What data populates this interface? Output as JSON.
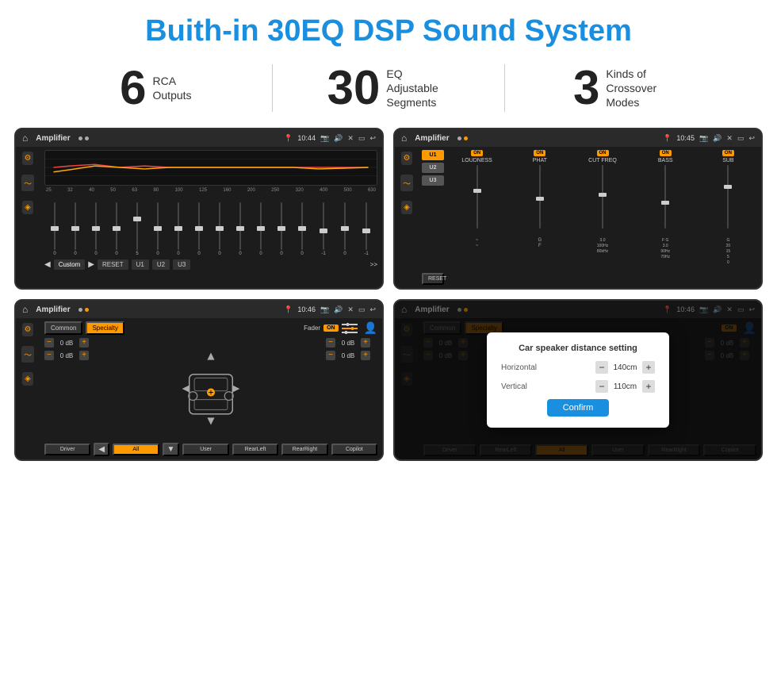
{
  "page": {
    "title": "Buith-in 30EQ DSP Sound System",
    "stats": [
      {
        "number": "6",
        "text": "RCA\nOutputs"
      },
      {
        "number": "30",
        "text": "EQ Adjustable\nSegments"
      },
      {
        "number": "3",
        "text": "Kinds of\nCrossover Modes"
      }
    ],
    "screens": [
      {
        "id": "eq-screen",
        "status_bar": {
          "app": "Amplifier",
          "time": "10:44"
        }
      },
      {
        "id": "crossover-screen",
        "status_bar": {
          "app": "Amplifier",
          "time": "10:45"
        }
      },
      {
        "id": "fader-screen",
        "status_bar": {
          "app": "Amplifier",
          "time": "10:46"
        }
      },
      {
        "id": "dialog-screen",
        "status_bar": {
          "app": "Amplifier",
          "time": "10:46"
        },
        "dialog": {
          "title": "Car speaker distance setting",
          "horizontal_label": "Horizontal",
          "horizontal_value": "140cm",
          "vertical_label": "Vertical",
          "vertical_value": "110cm",
          "confirm_label": "Confirm"
        }
      }
    ],
    "eq": {
      "freq_labels": [
        "25",
        "32",
        "40",
        "50",
        "63",
        "80",
        "100",
        "125",
        "160",
        "200",
        "250",
        "320",
        "400",
        "500",
        "630"
      ],
      "values": [
        "0",
        "0",
        "0",
        "0",
        "5",
        "0",
        "0",
        "0",
        "0",
        "0",
        "0",
        "0",
        "0",
        "-1",
        "0",
        "-1"
      ],
      "preset": "Custom",
      "buttons": [
        "RESET",
        "U1",
        "U2",
        "U3"
      ]
    },
    "crossover": {
      "u_buttons": [
        "U1",
        "U2",
        "U3"
      ],
      "controls": [
        {
          "label": "LOUDNESS",
          "on": true
        },
        {
          "label": "PHAT",
          "on": true
        },
        {
          "label": "CUT FREQ",
          "on": true
        },
        {
          "label": "BASS",
          "on": true
        },
        {
          "label": "SUB",
          "on": true
        }
      ],
      "reset_label": "RESET"
    },
    "fader": {
      "tabs": [
        "Common",
        "Specialty"
      ],
      "fader_label": "Fader",
      "on_label": "ON",
      "db_values": [
        "0 dB",
        "0 dB",
        "0 dB",
        "0 dB"
      ],
      "bottom_buttons": [
        "Driver",
        "RearLeft",
        "All",
        "User",
        "RearRight",
        "Copilot"
      ]
    }
  }
}
